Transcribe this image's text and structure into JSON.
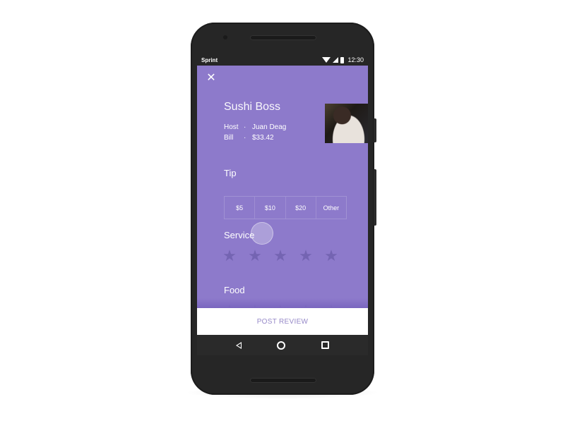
{
  "status_bar": {
    "carrier": "Sprint",
    "time": "12:30",
    "icons": [
      "wifi-icon",
      "signal-icon",
      "battery-icon"
    ]
  },
  "header": {
    "close_icon": "close-icon",
    "restaurant_name": "Sushi Boss",
    "host_label": "Host",
    "host_value": "Juan Deag",
    "bill_label": "Bill",
    "bill_value": "$33.42",
    "separator": "·"
  },
  "tip": {
    "label": "Tip",
    "options": [
      "$5",
      "$10",
      "$20",
      "Other"
    ]
  },
  "service": {
    "label": "Service",
    "rating": 0,
    "max_rating": 5
  },
  "food": {
    "label": "Food",
    "rating": 0,
    "max_rating": 5
  },
  "actions": {
    "post_review": "POST REVIEW"
  },
  "nav_bar": {
    "icons": [
      "back-icon",
      "home-icon",
      "recents-icon"
    ]
  },
  "colors": {
    "accent": "#8d7acb",
    "star_inactive": "#7464b2",
    "post_text": "#9689c8"
  }
}
